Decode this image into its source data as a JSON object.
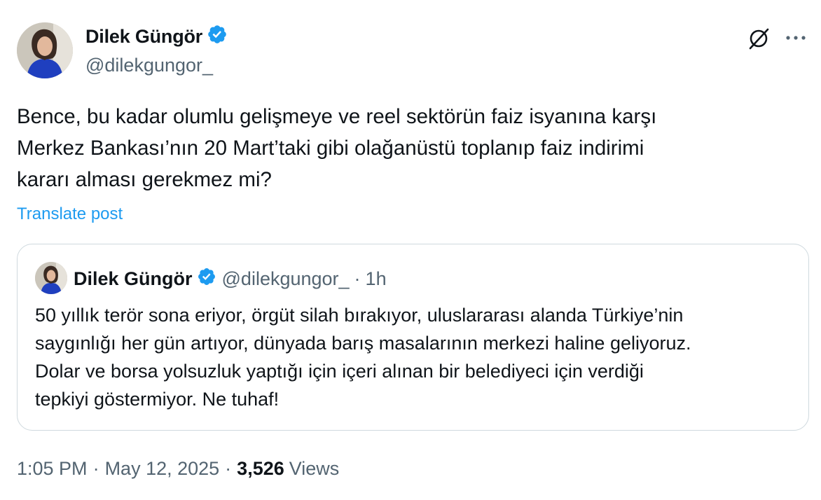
{
  "post": {
    "author": {
      "name": "Dilek Güngör",
      "handle": "@dilekgungor_",
      "verified": true
    },
    "text_lines": [
      "Bence, bu kadar olumlu gelişmeye ve reel sektörün faiz isyanına karşı",
      "Merkez Bankası’nın 20 Mart’taki gibi olağanüstü toplanıp faiz indirimi",
      "kararı alması gerekmez mi?"
    ],
    "translate_label": "Translate post",
    "quoted": {
      "name": "Dilek Güngör",
      "handle": "@dilekgungor_",
      "separator": "·",
      "time": "1h",
      "text_lines": [
        "50 yıllık terör sona eriyor, örgüt silah bırakıyor, uluslararası alanda Türkiye’nin",
        "saygınlığı her gün artıyor, dünyada barış masalarının merkezi haline geliyoruz.",
        "Dolar ve borsa yolsuzluk yaptığı için içeri alınan bir belediyeci için verdiği",
        "tepkiyi göstermiyor. Ne tuhaf!"
      ]
    },
    "meta": {
      "time": "1:05 PM",
      "separator": "·",
      "date": "May 12, 2025",
      "views_count": "3,526",
      "views_label": "Views"
    }
  },
  "icons": {
    "verified": "verified-badge-icon",
    "grok": "grok-icon",
    "more": "more-options-icon"
  },
  "colors": {
    "accent": "#1d9bf0",
    "secondary_text": "#536471",
    "border": "#cfd9de",
    "text": "#0f1419"
  }
}
